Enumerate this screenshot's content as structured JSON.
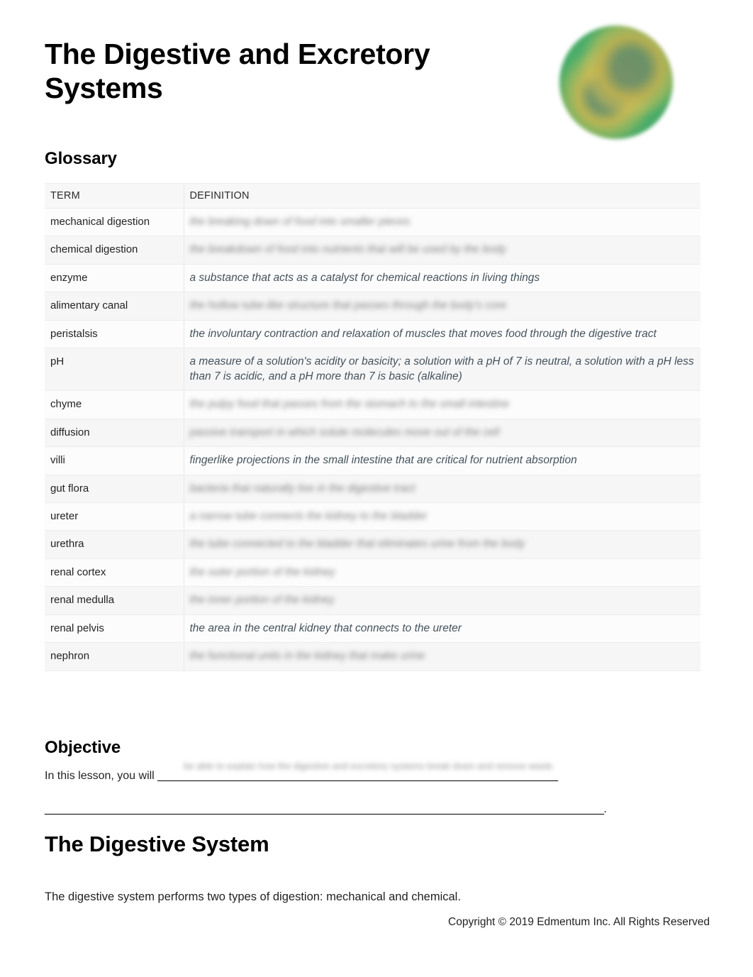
{
  "document": {
    "title": "The Digestive and Excretory Systems",
    "logo_icon": "cell-biology-logo-icon",
    "logo_colors": {
      "background_green": "#4faf6c",
      "ring_gold": "#c9b84e",
      "nucleus_olive": "#6e8e68"
    }
  },
  "glossary": {
    "heading": "Glossary",
    "columns": [
      "TERM",
      "DEFINITION"
    ],
    "rows": [
      {
        "term": "mechanical digestion",
        "definition": "the breaking down of food into smaller pieces",
        "redacted": true
      },
      {
        "term": "chemical digestion",
        "definition": "the breakdown of food into nutrients that will be used by the body",
        "redacted": true
      },
      {
        "term": "enzyme",
        "definition": "a substance that acts as a catalyst for chemical reactions in living things",
        "redacted": false
      },
      {
        "term": "alimentary canal",
        "definition": "the hollow tube-like structure that passes through the body's core",
        "redacted": true
      },
      {
        "term": "peristalsis",
        "definition": "the involuntary contraction and relaxation of muscles that moves food through the digestive tract",
        "redacted": false
      },
      {
        "term": "pH",
        "definition": "a measure of a solution's acidity or basicity; a solution with a pH of 7 is neutral, a solution with a pH less than 7 is acidic, and a pH more than 7 is basic (alkaline)",
        "redacted": false
      },
      {
        "term": "chyme",
        "definition": "the pulpy food that passes from the stomach to the small intestine",
        "redacted": true
      },
      {
        "term": "diffusion",
        "definition": "passive transport in which solute molecules move out of the cell",
        "redacted": true
      },
      {
        "term": "villi",
        "definition": "fingerlike projections in the small intestine that are critical for nutrient absorption",
        "redacted": false
      },
      {
        "term": "gut flora",
        "definition": "bacteria that naturally live in the digestive tract",
        "redacted": true
      },
      {
        "term": "ureter",
        "definition": "a narrow tube connects the kidney to the bladder",
        "redacted": true
      },
      {
        "term": "urethra",
        "definition": "the tube connected to the bladder that eliminates urine from the body",
        "redacted": true
      },
      {
        "term": "renal cortex",
        "definition": "the outer portion of the kidney",
        "redacted": true
      },
      {
        "term": "renal medulla",
        "definition": "the inner portion of the kidney",
        "redacted": true
      },
      {
        "term": "renal pelvis",
        "definition": "the area in the central kidney that connects to the ureter",
        "redacted": false
      },
      {
        "term": "nephron",
        "definition": "the functional units in the kidney that make urine",
        "redacted": true
      }
    ]
  },
  "objective": {
    "heading": "Objective",
    "lead_text": "In this lesson, you will ",
    "fill_in_text": "be able to explain how the digestive and excretory systems break down and remove waste",
    "blank_line_1": "____________________________________________________________________",
    "blank_line_2": "_______________________________________________________________________________________________.",
    "period": "."
  },
  "digestive_section": {
    "heading": "The Digestive System",
    "paragraph": "The digestive system performs two types of digestion: mechanical and chemical."
  },
  "footer": {
    "copyright": "Copyright © 2019 Edmentum Inc. All Rights Reserved"
  }
}
